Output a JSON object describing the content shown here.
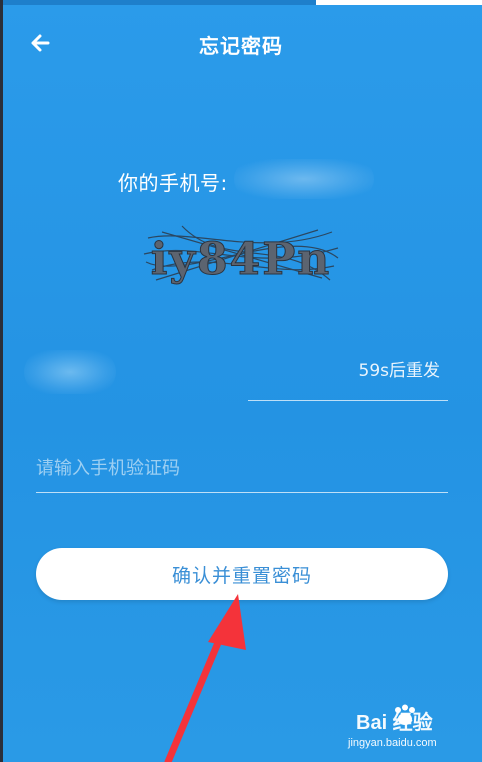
{
  "header": {
    "title": "忘记密码",
    "back_icon": "arrow-left-icon"
  },
  "phone": {
    "label": "你的手机号:"
  },
  "captcha": {
    "text": "iy84Pn"
  },
  "code_row": {
    "resend_label": "59s后重发"
  },
  "sms": {
    "placeholder": "请输入手机验证码"
  },
  "actions": {
    "confirm_label": "确认并重置密码"
  },
  "overlay": {
    "annotation_color": "#f4333a"
  },
  "watermark": {
    "brand": "Bai 经验",
    "url": "jingyan.baidu.com"
  },
  "colors": {
    "background": "#2493e3",
    "button_text": "#3a8fd6",
    "button_bg": "#ffffff"
  }
}
